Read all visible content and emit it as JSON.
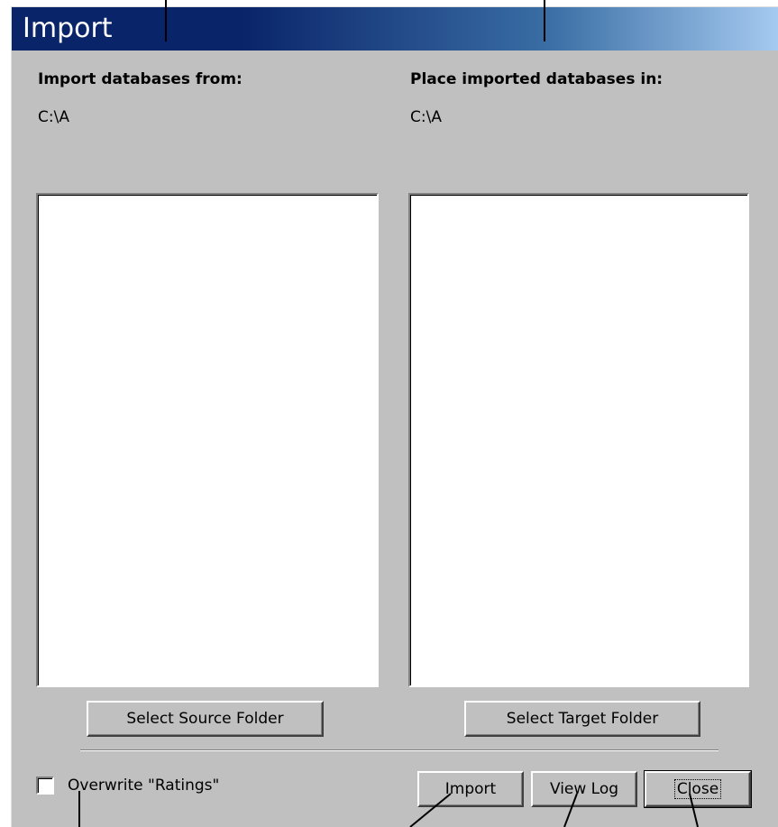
{
  "window": {
    "title": "Import"
  },
  "source": {
    "heading": "Import databases from:",
    "path": "C:\\A",
    "button_label": "Select Source Folder"
  },
  "target": {
    "heading": "Place imported databases in:",
    "path": "C:\\A",
    "button_label": "Select Target Folder"
  },
  "options": {
    "overwrite_label": "Overwrite  \"Ratings\"",
    "overwrite_checked": false
  },
  "actions": {
    "import_label": "Import",
    "view_log_label": "View Log",
    "close_label": "Close"
  },
  "colors": {
    "face": "#c0c0c0",
    "title_start": "#0a246a",
    "title_end": "#a6caf0"
  }
}
